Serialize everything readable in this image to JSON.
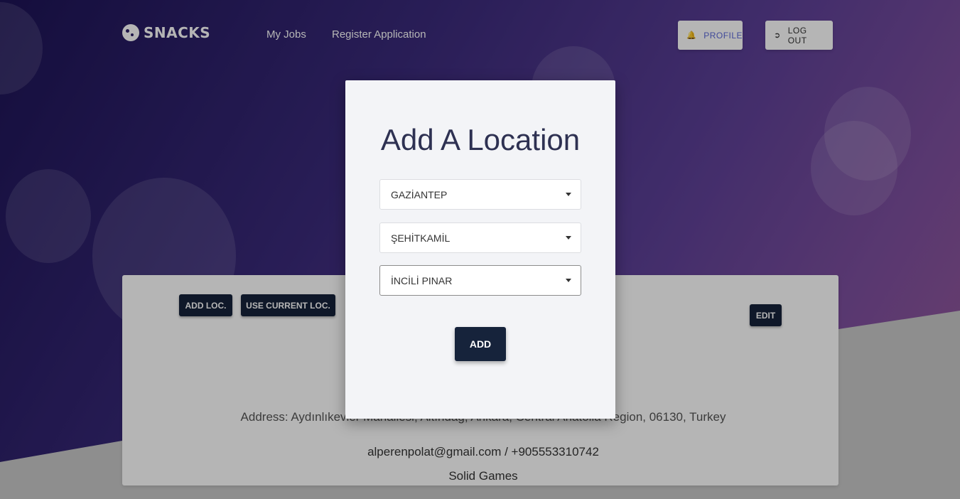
{
  "brand": {
    "name": "SNACKS"
  },
  "nav": {
    "links": [
      "My Jobs",
      "Register Application"
    ],
    "profile_label": "PROFILE",
    "logout_label": "LOG OUT"
  },
  "card": {
    "add_loc_label": "ADD LOC.",
    "use_current_label": "USE CURRENT LOC.",
    "edit_label": "EDIT",
    "address": "Address: Aydınlıkevler Mahallesi, Altındağ, Ankara, Central Anatolia Region, 06130, Turkey",
    "contact": "alperenpolat@gmail.com / +905553310742",
    "company": "Solid Games"
  },
  "modal": {
    "title": "Add A Location",
    "selects": {
      "city": "GAZİANTEP",
      "district": "ŞEHİTKAMİL",
      "neighborhood": "İNCİLİ PINAR"
    },
    "add_label": "ADD"
  },
  "icons": {
    "profile": "bell-icon",
    "logout": "logout-icon",
    "dropdown": "caret-down-icon"
  },
  "colors": {
    "accent_dark": "#16233b",
    "profile_text": "#5b67d8",
    "title_text": "#2e3152"
  }
}
